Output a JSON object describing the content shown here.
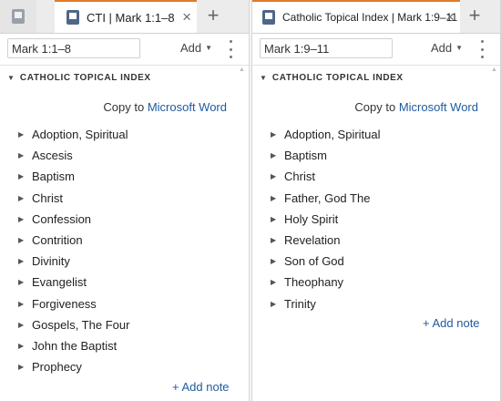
{
  "left_pane": {
    "tab_title": "CTI | Mark 1:1–8",
    "reference": "Mark 1:1–8",
    "add_label": "Add",
    "section_title": "CATHOLIC TOPICAL INDEX",
    "copy_prefix": "Copy to",
    "copy_link": "Microsoft Word",
    "topics": [
      "Adoption, Spiritual",
      "Ascesis",
      "Baptism",
      "Christ",
      "Confession",
      "Contrition",
      "Divinity",
      "Evangelist",
      "Forgiveness",
      "Gospels, The Four",
      "John the Baptist",
      "Prophecy"
    ],
    "add_note": "+ Add note"
  },
  "right_pane": {
    "tab_title": "Catholic Topical Index | Mark 1:9–11",
    "reference": "Mark 1:9–11",
    "add_label": "Add",
    "section_title": "CATHOLIC TOPICAL INDEX",
    "copy_prefix": "Copy to",
    "copy_link": "Microsoft Word",
    "topics": [
      "Adoption, Spiritual",
      "Baptism",
      "Christ",
      "Father, God The",
      "Holy Spirit",
      "Revelation",
      "Son of God",
      "Theophany",
      "Trinity"
    ],
    "add_note": "+ Add note"
  },
  "icons": {
    "close": "close-icon",
    "new_tab": "plus-icon",
    "menu": "kebab-menu-icon",
    "resource": "book-icon"
  },
  "colors": {
    "active_tab_accent": "#e07b2a",
    "link": "#1f5a9e",
    "book_icon": "#4f6787"
  }
}
